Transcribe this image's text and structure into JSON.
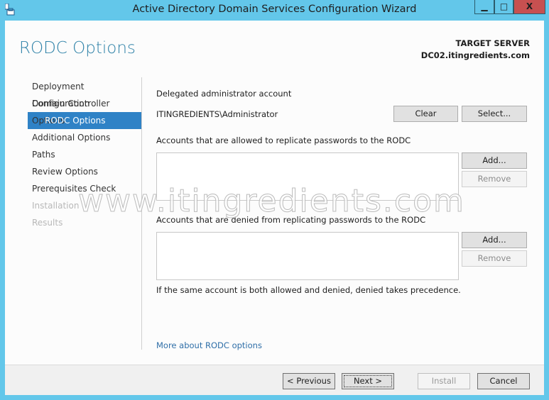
{
  "window": {
    "title": "Active Directory Domain Services Configuration Wizard",
    "minimize": "▬",
    "maximize": "□",
    "close": "X"
  },
  "header": {
    "title": "RODC Options",
    "target_label": "TARGET SERVER",
    "target_value": "DC02.itingredients.com"
  },
  "nav": [
    {
      "label": "Deployment Configuration",
      "state": "normal"
    },
    {
      "label": "Domain Controller Options",
      "state": "normal"
    },
    {
      "label": "RODC Options",
      "state": "active"
    },
    {
      "label": "Additional Options",
      "state": "normal"
    },
    {
      "label": "Paths",
      "state": "normal"
    },
    {
      "label": "Review Options",
      "state": "normal"
    },
    {
      "label": "Prerequisites Check",
      "state": "normal"
    },
    {
      "label": "Installation",
      "state": "disabled"
    },
    {
      "label": "Results",
      "state": "disabled"
    }
  ],
  "main": {
    "delegated_label": "Delegated administrator account",
    "delegated_value": "ITINGREDIENTS\\Administrator",
    "clear": "Clear",
    "select": "Select...",
    "allowed_label": "Accounts that are allowed to replicate passwords to the RODC",
    "denied_label": "Accounts that are denied from replicating passwords to the RODC",
    "add": "Add...",
    "remove": "Remove",
    "note": "If the same account is both allowed and denied, denied takes precedence.",
    "more_link": "More about RODC options"
  },
  "footer": {
    "previous": "< Previous",
    "next": "Next >",
    "install": "Install",
    "cancel": "Cancel"
  },
  "watermark": "www.itingredients.com"
}
